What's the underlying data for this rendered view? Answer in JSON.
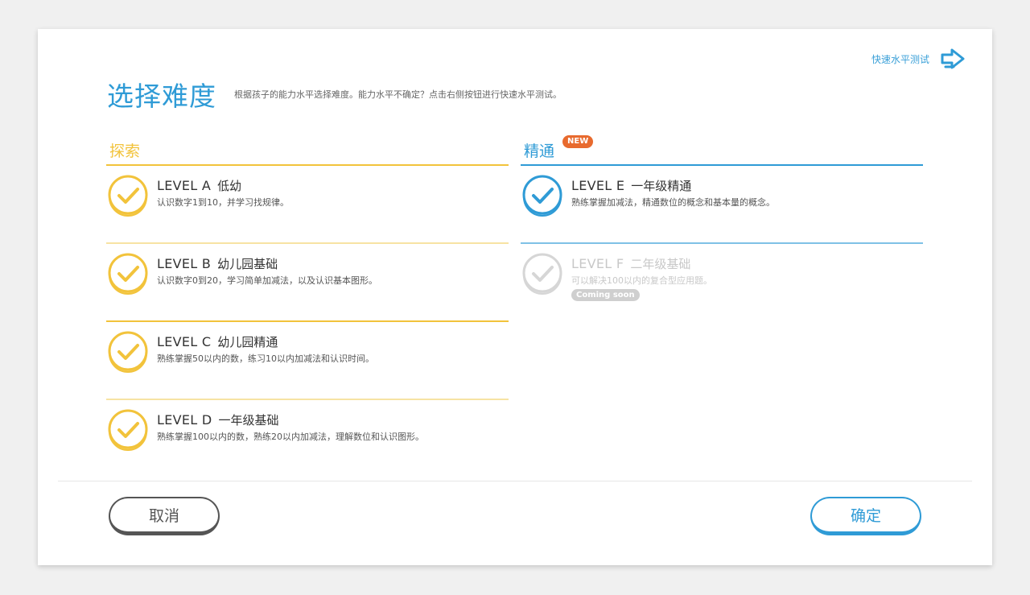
{
  "header": {
    "title": "选择难度",
    "description": "根据孩子的能力水平选择难度。能力水平不确定？点击右侧按钮进行快速水平测试。",
    "quick_test_label": "快速水平测试"
  },
  "colors": {
    "explore": "#f2c33b",
    "master": "#2f9bd6",
    "new_badge": "#e86a2e",
    "disabled": "#cfcfcf"
  },
  "sections": {
    "explore": {
      "title": "探索",
      "levels": [
        {
          "code": "LEVEL A",
          "name": "低幼",
          "desc": "认识数字1到10，并学习找规律。"
        },
        {
          "code": "LEVEL B",
          "name": "幼儿园基础",
          "desc": "认识数字0到20，学习简单加减法，以及认识基本图形。"
        },
        {
          "code": "LEVEL C",
          "name": "幼儿园精通",
          "desc": "熟练掌握50以内的数，练习10以内加减法和认识时间。"
        },
        {
          "code": "LEVEL D",
          "name": "一年级基础",
          "desc": "熟练掌握100以内的数，熟练20以内加减法，理解数位和认识图形。"
        }
      ]
    },
    "master": {
      "title": "精通",
      "badge": "NEW",
      "levels": [
        {
          "code": "LEVEL E",
          "name": "一年级精通",
          "desc": "熟练掌握加减法，精通数位的概念和基本量的概念。"
        },
        {
          "code": "LEVEL F",
          "name": "二年级基础",
          "desc": "可以解决100以内的复合型应用题。",
          "status": "Coming soon"
        }
      ]
    }
  },
  "footer": {
    "cancel_label": "取消",
    "ok_label": "确定"
  }
}
